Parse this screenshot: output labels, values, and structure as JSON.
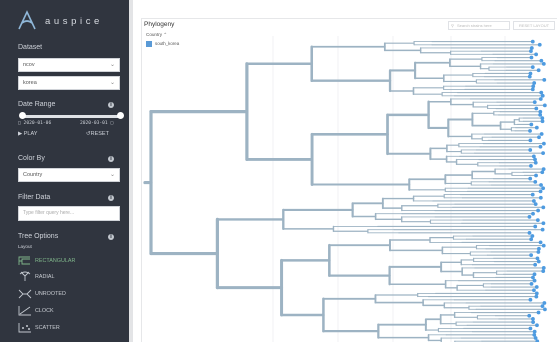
{
  "app": {
    "name": "auspice"
  },
  "sidebar": {
    "dataset": {
      "title": "Dataset",
      "selects": [
        "ncov",
        "korea"
      ]
    },
    "date_range": {
      "title": "Date Range",
      "start": "2020-01-06",
      "end": "2020-03-01",
      "play_label": "PLAY",
      "reset_label": "RESET",
      "start_fraction": 0.0,
      "end_fraction": 1.0
    },
    "color_by": {
      "title": "Color By",
      "value": "Country"
    },
    "filter": {
      "title": "Filter Data",
      "placeholder": "Type filter query here..."
    },
    "tree_options": {
      "title": "Tree Options",
      "layout_title": "Layout",
      "layouts": [
        {
          "label": "RECTANGULAR",
          "icon": "rectangular-layout-icon",
          "selected": true
        },
        {
          "label": "RADIAL",
          "icon": "radial-layout-icon",
          "selected": false
        },
        {
          "label": "UNROOTED",
          "icon": "unrooted-layout-icon",
          "selected": false
        },
        {
          "label": "CLOCK",
          "icon": "clock-layout-icon",
          "selected": false
        },
        {
          "label": "SCATTER",
          "icon": "scatter-layout-icon",
          "selected": false
        }
      ]
    }
  },
  "panel": {
    "title": "Phylogeny",
    "legend": {
      "title": "Country",
      "items": [
        {
          "label": "south_korea",
          "color": "#5a9ad6"
        }
      ]
    },
    "search_placeholder": "Search strains here",
    "reset_label": "RESET LAYOUT"
  },
  "colors": {
    "branch": "#9db3c3",
    "tip": "#4e9be0",
    "sidebar_bg": "#30353f",
    "accent": "#7fb58a"
  }
}
